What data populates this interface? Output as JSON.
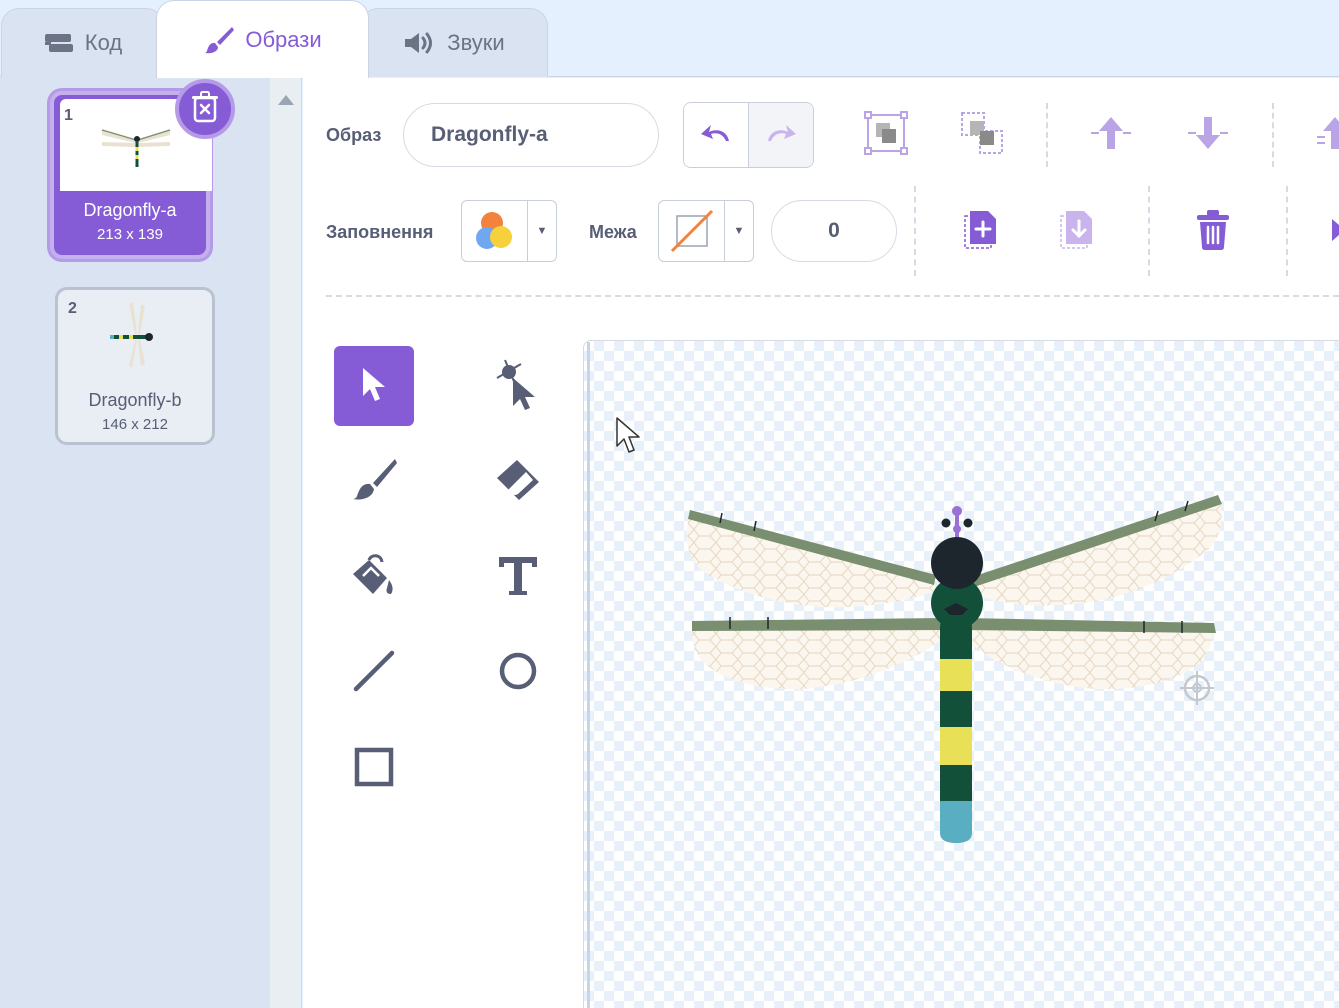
{
  "tabs": [
    {
      "label": "Код",
      "icon": "code-icon"
    },
    {
      "label": "Образи",
      "icon": "brush-icon"
    },
    {
      "label": "Звуки",
      "icon": "speaker-icon"
    }
  ],
  "costumes": [
    {
      "num": "1",
      "name": "Dragonfly-a",
      "size": "213 x 139"
    },
    {
      "num": "2",
      "name": "Dragonfly-b",
      "size": "146 x 212"
    }
  ],
  "toolbar": {
    "costume_label": "Образ",
    "costume_name": "Dragonfly-a",
    "fill_label": "Заповнення",
    "outline_label": "Межа",
    "outline_width": "0"
  },
  "tools": [
    "select-tool",
    "reshape-tool",
    "brush-tool",
    "eraser-tool",
    "fill-tool",
    "text-tool",
    "line-tool",
    "circle-tool",
    "rectangle-tool"
  ],
  "colors": {
    "accent": "#855cd6",
    "fill_swatch": [
      "#f2823c",
      "#6fa8f0",
      "#f7d13c"
    ],
    "outline_swatch": "#f2823c"
  }
}
